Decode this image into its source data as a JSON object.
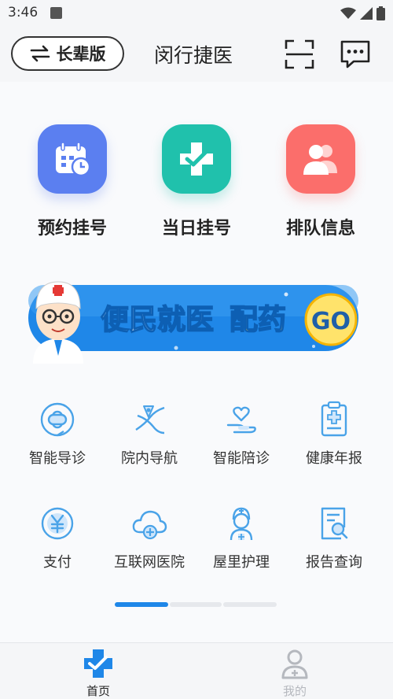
{
  "status_bar": {
    "time": "3:46"
  },
  "header": {
    "elder_mode_label": "长辈版",
    "title": "闵行捷医"
  },
  "main_actions": [
    {
      "label": "预约挂号",
      "icon": "calendar-clock-icon",
      "color": "#5b7ff0"
    },
    {
      "label": "当日挂号",
      "icon": "cross-check-icon",
      "color": "#20c1ac"
    },
    {
      "label": "排队信息",
      "icon": "people-icon",
      "color": "#fb6e6b"
    }
  ],
  "banner": {
    "text_a": "便民就医",
    "text_b": "配药",
    "go": "GO"
  },
  "services": [
    {
      "label": "智能导诊",
      "icon": "smart-guide-icon"
    },
    {
      "label": "院内导航",
      "icon": "navigation-icon"
    },
    {
      "label": "智能陪诊",
      "icon": "heart-hand-icon"
    },
    {
      "label": "健康年报",
      "icon": "health-report-icon"
    },
    {
      "label": "支付",
      "icon": "yuan-icon"
    },
    {
      "label": "互联网医院",
      "icon": "cloud-plus-icon"
    },
    {
      "label": "屋里护理",
      "icon": "nurse-icon"
    },
    {
      "label": "报告查询",
      "icon": "report-search-icon"
    }
  ],
  "tabbar": [
    {
      "label": "首页",
      "active": true
    },
    {
      "label": "我的",
      "active": false
    }
  ],
  "colors": {
    "accent": "#1f87e8",
    "icon_blue": "#4aa3e8",
    "inactive": "#b5b8be"
  }
}
